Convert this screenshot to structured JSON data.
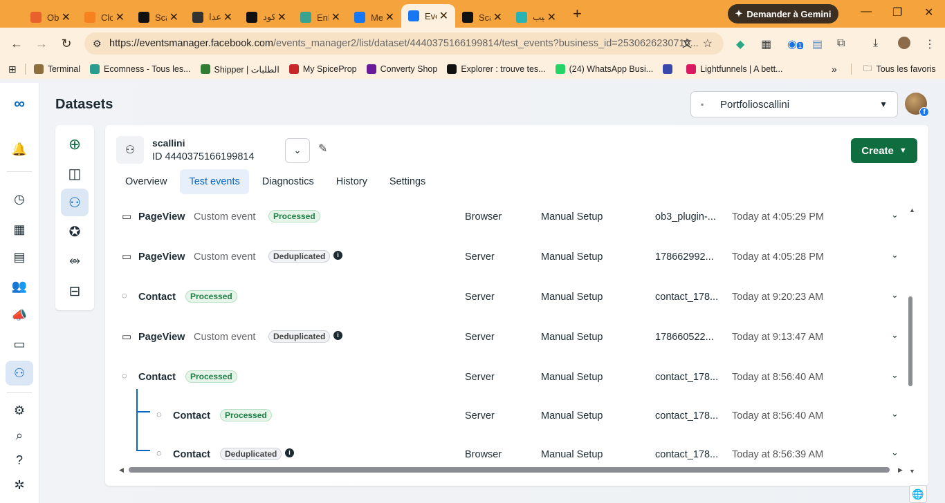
{
  "browser": {
    "tabs": [
      {
        "label": "Obs",
        "color": "#e8612c"
      },
      {
        "label": "Clou",
        "color": "#f6821f"
      },
      {
        "label": "Scal",
        "color": "#111111"
      },
      {
        "label": "إعدا",
        "color": "#333333"
      },
      {
        "label": "كود",
        "color": "#111111"
      },
      {
        "label": "Enle",
        "color": "#3aa38f"
      },
      {
        "label": "Met",
        "color": "#1877f2"
      },
      {
        "label": "Evei",
        "color": "#1877f2",
        "active": true
      },
      {
        "label": "Scal",
        "color": "#111111"
      },
      {
        "label": "ترتيب",
        "color": "#2ab3b3"
      }
    ],
    "gemini_label": "Demander à Gemini",
    "url_host": "https://eventsmanager.facebook.com",
    "url_path": "/events_manager2/list/dataset/4440375166199814/test_events?business_id=2530626230716...",
    "ext_badge": "1",
    "bookmarks": [
      {
        "label": "Terminal",
        "color": "#8d6e3f"
      },
      {
        "label": "Ecomness - Tous les...",
        "color": "#2a9d8f"
      },
      {
        "label": "Shipper | الطلبات",
        "color": "#2e7d32"
      },
      {
        "label": "My SpiceProp",
        "color": "#c62828"
      },
      {
        "label": "Converty Shop",
        "color": "#6a1b9a"
      },
      {
        "label": "Explorer : trouve tes...",
        "color": "#111111"
      },
      {
        "label": "(24) WhatsApp Busi...",
        "color": "#25d366"
      },
      {
        "label": "",
        "color": "#3949ab"
      },
      {
        "label": "Lightfunnels | A bett...",
        "color": "#d81b60"
      }
    ],
    "all_bookmarks": "Tous les favoris"
  },
  "page": {
    "title": "Datasets",
    "portfolio": "Portfolioscallini",
    "dataset_name": "scallini",
    "dataset_id": "ID 4440375166199814",
    "create_label": "Create",
    "tabs": [
      "Overview",
      "Test events",
      "Diagnostics",
      "History",
      "Settings"
    ],
    "active_tab": "Test events"
  },
  "events": [
    {
      "name": "PageView",
      "custom": "Custom event",
      "status": "Processed",
      "source": "Browser",
      "method": "Manual Setup",
      "id": "ob3_plugin-...",
      "time": "Today at 4:05:29 PM"
    },
    {
      "name": "PageView",
      "custom": "Custom event",
      "status": "Deduplicated",
      "source": "Server",
      "method": "Manual Setup",
      "id": "178662992...",
      "time": "Today at 4:05:28 PM"
    },
    {
      "name": "Contact",
      "custom": "",
      "status": "Processed",
      "source": "Server",
      "method": "Manual Setup",
      "id": "contact_178...",
      "time": "Today at 9:20:23 AM"
    },
    {
      "name": "PageView",
      "custom": "Custom event",
      "status": "Deduplicated",
      "source": "Server",
      "method": "Manual Setup",
      "id": "178660522...",
      "time": "Today at 9:13:47 AM"
    },
    {
      "name": "Contact",
      "custom": "",
      "status": "Processed",
      "source": "Server",
      "method": "Manual Setup",
      "id": "contact_178...",
      "time": "Today at 8:56:40 AM"
    },
    {
      "name": "Contact",
      "custom": "",
      "status": "Processed",
      "source": "Server",
      "method": "Manual Setup",
      "id": "contact_178...",
      "time": "Today at 8:56:40 AM",
      "child": true
    },
    {
      "name": "Contact",
      "custom": "",
      "status": "Deduplicated",
      "source": "Browser",
      "method": "Manual Setup",
      "id": "contact_178...",
      "time": "Today at 8:56:39 AM",
      "child": true
    }
  ]
}
